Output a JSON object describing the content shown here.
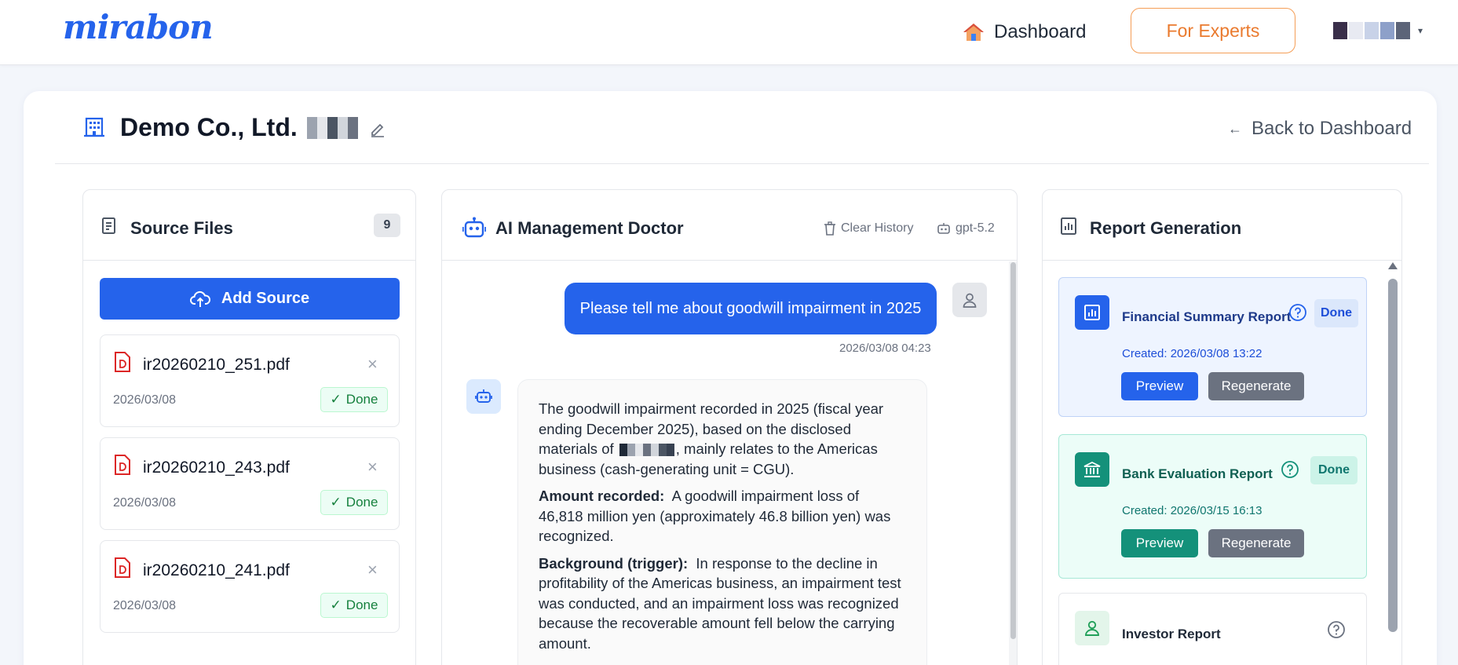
{
  "topbar": {
    "logo": "mirabon",
    "dashboard_label": "Dashboard",
    "experts_label": "For Experts",
    "user_caret": "▾"
  },
  "header": {
    "company_name": "Demo Co., Ltd.",
    "back_label": "Back to Dashboard",
    "back_arrow": "←"
  },
  "sources": {
    "title": "Source Files",
    "count": "9",
    "add_label": "Add Source",
    "files": [
      {
        "name": "ir20260210_251.pdf",
        "date": "2026/03/08",
        "status": "Done"
      },
      {
        "name": "ir20260210_243.pdf",
        "date": "2026/03/08",
        "status": "Done"
      },
      {
        "name": "ir20260210_241.pdf",
        "date": "2026/03/08",
        "status": "Done"
      }
    ],
    "close_glyph": "×",
    "check_glyph": "✓"
  },
  "chat": {
    "title": "AI Management Doctor",
    "clear_label": "Clear History",
    "model_label": "gpt-5.2",
    "user_message": "Please tell me about goodwill impairment in 2025",
    "user_timestamp": "2026/03/08 04:23",
    "bot_p1_a": "The goodwill impairment recorded in 2025 (fiscal year ending December 2025), based on the disclosed materials of",
    "bot_p1_b": ", mainly relates to the Americas business (cash-generating unit = CGU).",
    "bot_p2_label": "Amount recorded:",
    "bot_p2_text": "A goodwill impairment loss of 46,818 million yen (approximately 46.8 billion yen) was recognized.",
    "bot_p3_label": "Background (trigger):",
    "bot_p3_text": "In response to the decline in profitability of the Americas business, an impairment test was conducted, and an impairment loss was recognized because the recoverable amount fell below the carrying amount."
  },
  "reports": {
    "title": "Report Generation",
    "items": [
      {
        "title": "Financial Summary Report",
        "status": "Done",
        "created": "Created: 2026/03/08 13:22",
        "preview": "Preview",
        "regenerate": "Regenerate"
      },
      {
        "title": "Bank Evaluation Report",
        "status": "Done",
        "created": "Created: 2026/03/15 16:13",
        "preview": "Preview",
        "regenerate": "Regenerate"
      },
      {
        "title": "Investor Report"
      }
    ]
  },
  "colors": {
    "primary": "#2563eb",
    "accent_orange": "#ea7a2e",
    "teal": "#14917a",
    "success": "#15803d",
    "gray_button": "#6b7280"
  },
  "icons": [
    "house-icon",
    "building-icon",
    "edit-icon",
    "document-icon",
    "cloud-upload-icon",
    "pdf-file-icon",
    "robot-icon",
    "trash-icon",
    "user-icon",
    "bar-chart-icon",
    "bank-icon",
    "help-icon",
    "arrow-left-icon"
  ]
}
